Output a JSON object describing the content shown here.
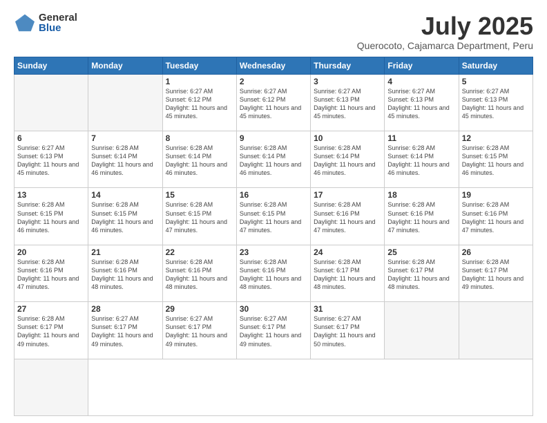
{
  "logo": {
    "general": "General",
    "blue": "Blue"
  },
  "title": {
    "month": "July 2025",
    "location": "Querocoto, Cajamarca Department, Peru"
  },
  "weekdays": [
    "Sunday",
    "Monday",
    "Tuesday",
    "Wednesday",
    "Thursday",
    "Friday",
    "Saturday"
  ],
  "days": [
    {
      "day": "",
      "info": ""
    },
    {
      "day": "",
      "info": ""
    },
    {
      "day": "1",
      "info": "Sunrise: 6:27 AM\nSunset: 6:12 PM\nDaylight: 11 hours and 45 minutes."
    },
    {
      "day": "2",
      "info": "Sunrise: 6:27 AM\nSunset: 6:12 PM\nDaylight: 11 hours and 45 minutes."
    },
    {
      "day": "3",
      "info": "Sunrise: 6:27 AM\nSunset: 6:13 PM\nDaylight: 11 hours and 45 minutes."
    },
    {
      "day": "4",
      "info": "Sunrise: 6:27 AM\nSunset: 6:13 PM\nDaylight: 11 hours and 45 minutes."
    },
    {
      "day": "5",
      "info": "Sunrise: 6:27 AM\nSunset: 6:13 PM\nDaylight: 11 hours and 45 minutes."
    },
    {
      "day": "6",
      "info": "Sunrise: 6:27 AM\nSunset: 6:13 PM\nDaylight: 11 hours and 45 minutes."
    },
    {
      "day": "7",
      "info": "Sunrise: 6:28 AM\nSunset: 6:14 PM\nDaylight: 11 hours and 46 minutes."
    },
    {
      "day": "8",
      "info": "Sunrise: 6:28 AM\nSunset: 6:14 PM\nDaylight: 11 hours and 46 minutes."
    },
    {
      "day": "9",
      "info": "Sunrise: 6:28 AM\nSunset: 6:14 PM\nDaylight: 11 hours and 46 minutes."
    },
    {
      "day": "10",
      "info": "Sunrise: 6:28 AM\nSunset: 6:14 PM\nDaylight: 11 hours and 46 minutes."
    },
    {
      "day": "11",
      "info": "Sunrise: 6:28 AM\nSunset: 6:14 PM\nDaylight: 11 hours and 46 minutes."
    },
    {
      "day": "12",
      "info": "Sunrise: 6:28 AM\nSunset: 6:15 PM\nDaylight: 11 hours and 46 minutes."
    },
    {
      "day": "13",
      "info": "Sunrise: 6:28 AM\nSunset: 6:15 PM\nDaylight: 11 hours and 46 minutes."
    },
    {
      "day": "14",
      "info": "Sunrise: 6:28 AM\nSunset: 6:15 PM\nDaylight: 11 hours and 46 minutes."
    },
    {
      "day": "15",
      "info": "Sunrise: 6:28 AM\nSunset: 6:15 PM\nDaylight: 11 hours and 47 minutes."
    },
    {
      "day": "16",
      "info": "Sunrise: 6:28 AM\nSunset: 6:15 PM\nDaylight: 11 hours and 47 minutes."
    },
    {
      "day": "17",
      "info": "Sunrise: 6:28 AM\nSunset: 6:16 PM\nDaylight: 11 hours and 47 minutes."
    },
    {
      "day": "18",
      "info": "Sunrise: 6:28 AM\nSunset: 6:16 PM\nDaylight: 11 hours and 47 minutes."
    },
    {
      "day": "19",
      "info": "Sunrise: 6:28 AM\nSunset: 6:16 PM\nDaylight: 11 hours and 47 minutes."
    },
    {
      "day": "20",
      "info": "Sunrise: 6:28 AM\nSunset: 6:16 PM\nDaylight: 11 hours and 47 minutes."
    },
    {
      "day": "21",
      "info": "Sunrise: 6:28 AM\nSunset: 6:16 PM\nDaylight: 11 hours and 48 minutes."
    },
    {
      "day": "22",
      "info": "Sunrise: 6:28 AM\nSunset: 6:16 PM\nDaylight: 11 hours and 48 minutes."
    },
    {
      "day": "23",
      "info": "Sunrise: 6:28 AM\nSunset: 6:16 PM\nDaylight: 11 hours and 48 minutes."
    },
    {
      "day": "24",
      "info": "Sunrise: 6:28 AM\nSunset: 6:17 PM\nDaylight: 11 hours and 48 minutes."
    },
    {
      "day": "25",
      "info": "Sunrise: 6:28 AM\nSunset: 6:17 PM\nDaylight: 11 hours and 48 minutes."
    },
    {
      "day": "26",
      "info": "Sunrise: 6:28 AM\nSunset: 6:17 PM\nDaylight: 11 hours and 49 minutes."
    },
    {
      "day": "27",
      "info": "Sunrise: 6:28 AM\nSunset: 6:17 PM\nDaylight: 11 hours and 49 minutes."
    },
    {
      "day": "28",
      "info": "Sunrise: 6:27 AM\nSunset: 6:17 PM\nDaylight: 11 hours and 49 minutes."
    },
    {
      "day": "29",
      "info": "Sunrise: 6:27 AM\nSunset: 6:17 PM\nDaylight: 11 hours and 49 minutes."
    },
    {
      "day": "30",
      "info": "Sunrise: 6:27 AM\nSunset: 6:17 PM\nDaylight: 11 hours and 49 minutes."
    },
    {
      "day": "31",
      "info": "Sunrise: 6:27 AM\nSunset: 6:17 PM\nDaylight: 11 hours and 50 minutes."
    },
    {
      "day": "",
      "info": ""
    },
    {
      "day": "",
      "info": ""
    },
    {
      "day": "",
      "info": ""
    }
  ]
}
